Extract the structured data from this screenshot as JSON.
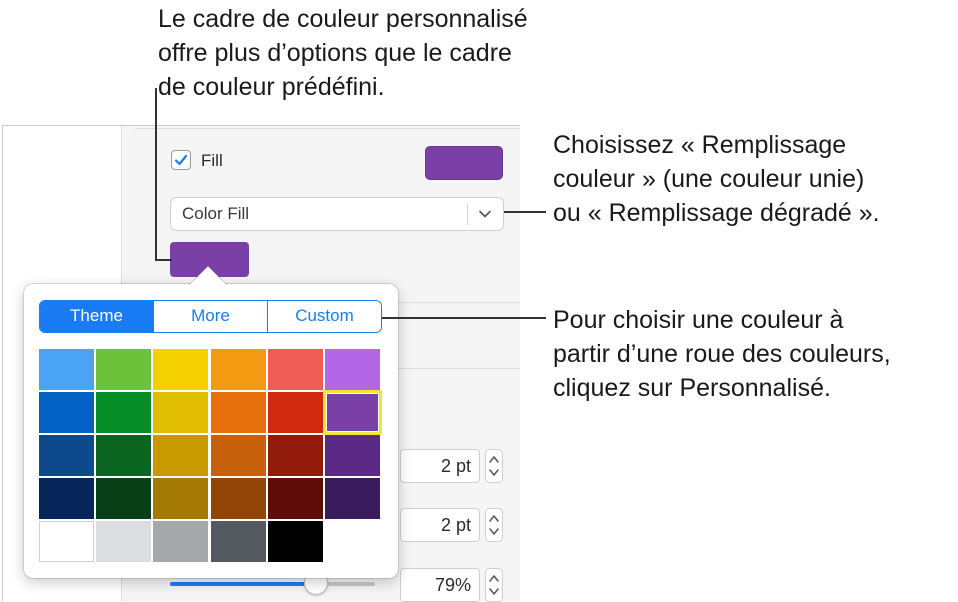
{
  "callouts": {
    "top": "Le cadre de couleur personnalisé\noffre plus d’options que le cadre\nde couleur prédéfini.",
    "right_top": "Choisissez « Remplissage\ncouleur » (une couleur unie)\nou « Remplissage dégradé ».",
    "right_bottom": "Pour choisir une couleur à\npartir d’une roue des couleurs,\ncliquez sur Personnalisé."
  },
  "fill": {
    "label": "Fill",
    "checked": true,
    "swatch_color": "#7b3fa8",
    "popup_value": "Color Fill"
  },
  "popover": {
    "tabs": [
      {
        "label": "Theme",
        "active": true
      },
      {
        "label": "More",
        "active": false
      },
      {
        "label": "Custom",
        "active": false
      }
    ],
    "colors": [
      [
        "#4aa3f5",
        "#6cc23a",
        "#f4d000",
        "#f39a12",
        "#ee5c55",
        "#b267e6"
      ],
      [
        "#0563c8",
        "#058d27",
        "#e1bd00",
        "#e7700d",
        "#cf2a0e",
        "#7b3fa8"
      ],
      [
        "#0e4a8b",
        "#0b6521",
        "#c89a00",
        "#c6600b",
        "#921b0b",
        "#5b2a87"
      ],
      [
        "#062558",
        "#083f16",
        "#a57a04",
        "#934508",
        "#5f0d08",
        "#3a1c5c"
      ],
      [
        "#ffffff",
        "#dcdddf",
        "#a5a8a9",
        "#545960",
        "#000000",
        null
      ]
    ],
    "selected": [
      1,
      5
    ]
  },
  "controls": {
    "field1": "2 pt",
    "field2": "2 pt",
    "field3": "79%",
    "slider_value": 0.79
  },
  "accent_color": "#1a7cf5"
}
